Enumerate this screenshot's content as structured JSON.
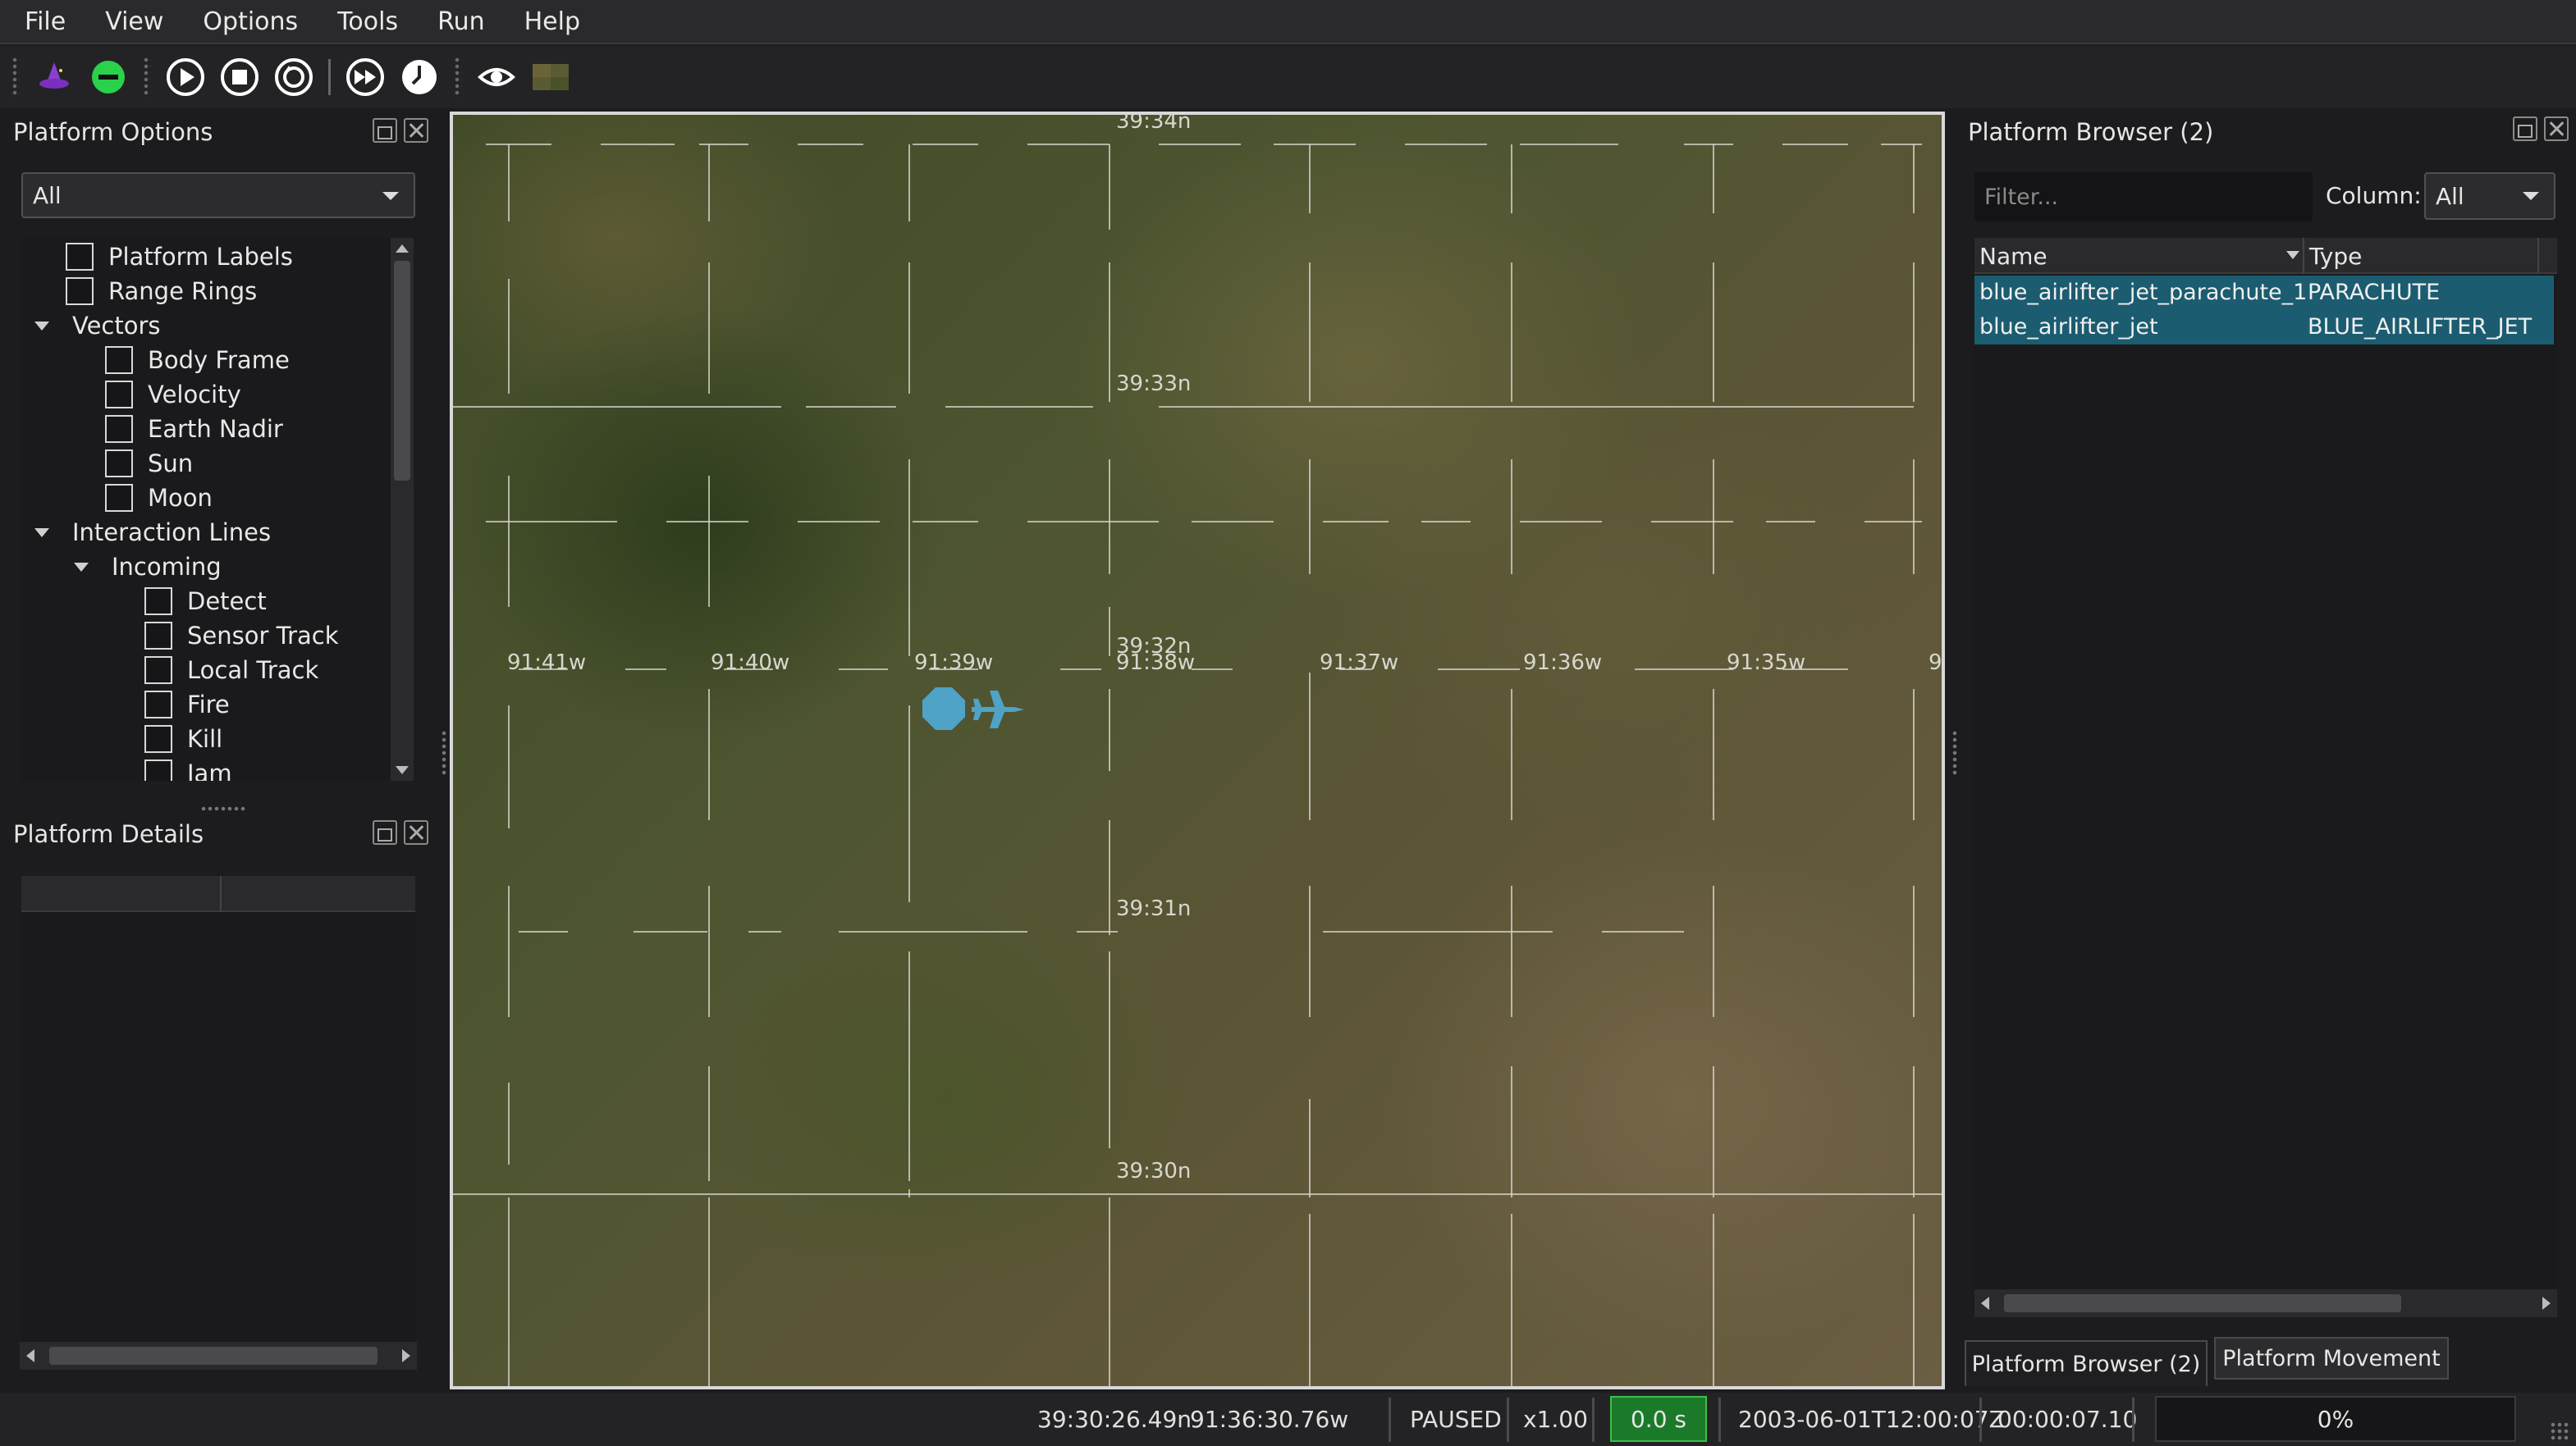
{
  "menu": [
    "File",
    "View",
    "Options",
    "Tools",
    "Run",
    "Help"
  ],
  "toolbar": {
    "icons": [
      "wizard-icon",
      "minus-circle-icon",
      "play-icon",
      "stop-icon",
      "restart-icon",
      "fast-forward-icon",
      "clock-icon",
      "eye-icon",
      "map-tile-icon"
    ]
  },
  "platform_options": {
    "title": "Platform Options",
    "filter_value": "All",
    "tree": [
      {
        "label": "Platform Labels",
        "level": 0,
        "kind": "check",
        "checked": false
      },
      {
        "label": "Range Rings",
        "level": 0,
        "kind": "check",
        "checked": false
      },
      {
        "label": "Vectors",
        "level": 0,
        "kind": "group",
        "expanded": true
      },
      {
        "label": "Body Frame",
        "level": 1,
        "kind": "check",
        "checked": false
      },
      {
        "label": "Velocity",
        "level": 1,
        "kind": "check",
        "checked": false
      },
      {
        "label": "Earth Nadir",
        "level": 1,
        "kind": "check",
        "checked": false
      },
      {
        "label": "Sun",
        "level": 1,
        "kind": "check",
        "checked": false
      },
      {
        "label": "Moon",
        "level": 1,
        "kind": "check",
        "checked": false
      },
      {
        "label": "Interaction Lines",
        "level": 0,
        "kind": "group",
        "expanded": true
      },
      {
        "label": "Incoming",
        "level": 1,
        "kind": "group",
        "expanded": true
      },
      {
        "label": "Detect",
        "level": 2,
        "kind": "check",
        "checked": false
      },
      {
        "label": "Sensor Track",
        "level": 2,
        "kind": "check",
        "checked": false
      },
      {
        "label": "Local Track",
        "level": 2,
        "kind": "check",
        "checked": false
      },
      {
        "label": "Fire",
        "level": 2,
        "kind": "check",
        "checked": false
      },
      {
        "label": "Kill",
        "level": 2,
        "kind": "check",
        "checked": false
      },
      {
        "label": "Jam",
        "level": 2,
        "kind": "check",
        "checked": false
      }
    ]
  },
  "platform_details": {
    "title": "Platform Details"
  },
  "map": {
    "lat_labels": [
      "39:34n",
      "39:33n",
      "39:32n",
      "39:31n",
      "39:30n"
    ],
    "lon_labels": [
      "91:41w",
      "91:40w",
      "91:39w",
      "91:38w",
      "91:37w",
      "91:36w",
      "91:35w",
      "9"
    ],
    "platform_color": "#4fa3c7"
  },
  "platform_browser": {
    "title": "Platform Browser (2)",
    "filter_placeholder": "Filter...",
    "column_label": "Column:",
    "column_value": "All",
    "headers": [
      "Name",
      "Type"
    ],
    "rows": [
      {
        "name": "blue_airlifter_jet_parachute_1",
        "type": "PARACHUTE"
      },
      {
        "name": "blue_airlifter_jet",
        "type": "BLUE_AIRLIFTER_JET"
      }
    ],
    "selected_row_color": "#1b5c70"
  },
  "bottom_tabs": [
    "Platform Browser (2)",
    "Platform Movement"
  ],
  "status": {
    "lat": "39:30:26.49n",
    "lon": "91:36:30.76w",
    "state": "PAUSED",
    "speed": "x1.00",
    "sim_time": "0.0 s",
    "datetime": "2003-06-01T12:00:07Z",
    "elapsed": "00:00:07.10",
    "progress": "0%"
  }
}
